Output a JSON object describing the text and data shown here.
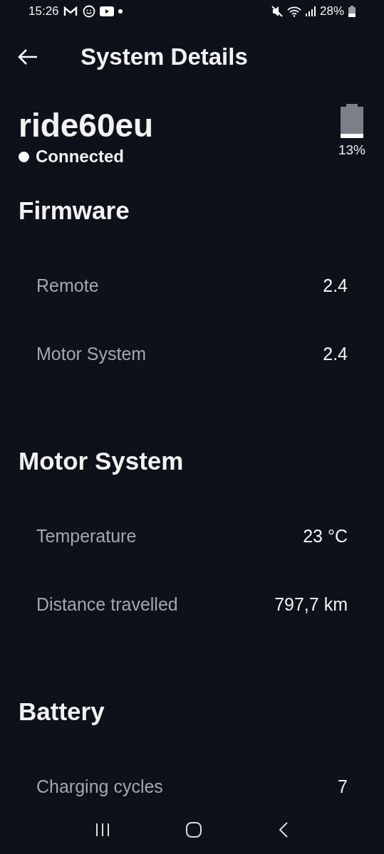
{
  "status_bar": {
    "time": "15:26",
    "battery_percent": "28%"
  },
  "app_bar": {
    "title": "System Details"
  },
  "device": {
    "name": "ride60eu",
    "status": "Connected",
    "battery": {
      "reading": "13%"
    }
  },
  "sections": [
    {
      "title": "Firmware",
      "rows": [
        {
          "label": "Remote",
          "value": "2.4"
        },
        {
          "label": "Motor System",
          "value": "2.4"
        }
      ]
    },
    {
      "title": "Motor System",
      "rows": [
        {
          "label": "Temperature",
          "value": "23 °C"
        },
        {
          "label": "Distance travelled",
          "value": "797,7 km"
        }
      ]
    },
    {
      "title": "Battery",
      "rows": [
        {
          "label": "Charging cycles",
          "value": "7"
        }
      ]
    }
  ]
}
